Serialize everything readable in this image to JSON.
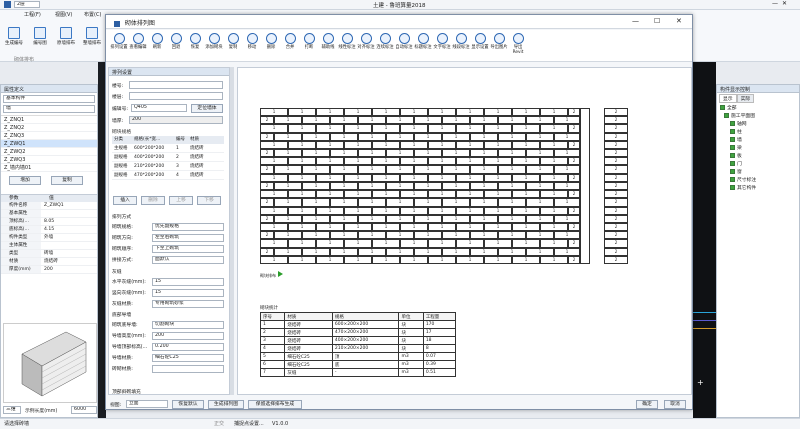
{
  "app": {
    "title": "土建 - 鲁班算量2018",
    "floor": "2层",
    "menus": [
      "工程(F)",
      "视图(V)",
      "布置(C)"
    ],
    "ribbon_tools": [
      "生成编号",
      "编号图",
      "原墙排布",
      "整墙排布"
    ],
    "ribbon_group": "砌体排布"
  },
  "props": {
    "title": "属性定义",
    "filter1": "基本构件",
    "filter2": "墙",
    "items": [
      "Z_ZNQ1",
      "Z_ZNQ2",
      "Z_ZNQ3",
      "Z_ZWQ1",
      "Z_ZWQ2",
      "Z_ZWQ3",
      "Z_墙内墙01"
    ],
    "selected": 3,
    "btn_add": "增加",
    "btn_copy": "复制",
    "grid_head": [
      "参数",
      "值"
    ],
    "rows": [
      [
        "构件名称",
        "Z_ZWQ1"
      ],
      [
        "基本属性",
        ""
      ],
      [
        "顶标高(...",
        "8.05"
      ],
      [
        "底标高(...",
        "4.15"
      ],
      [
        "构件类型",
        "外墙"
      ],
      [
        "主体属性",
        ""
      ],
      [
        "类型",
        "砖墙"
      ],
      [
        "材质",
        "烧结砖"
      ],
      [
        "厚度(mm)",
        "200"
      ]
    ],
    "bottom_view": "三维",
    "bottom_label": "示例长度(mm)",
    "bottom_value": "6000"
  },
  "dialog": {
    "title": "砌体排列图",
    "tools": [
      "排列设置",
      "查看编辑",
      "刷新",
      "回退",
      "恢复",
      "添加砌块",
      "复制",
      "移动",
      "删除",
      "合并",
      "打断",
      "辅助线",
      "线性标注",
      "对齐标注",
      "连续标注",
      "自动标注",
      "标题标注",
      "文字标注",
      "线段标注",
      "显示设置",
      "导出图片",
      "导出Revit"
    ],
    "settings_title": "排列设置",
    "l_floor": "楼号:",
    "l_num": "楼层:",
    "l_code": "编辑号:",
    "code_value": "Q405",
    "btn_locate": "定位墙体",
    "l_height": "墙厚:",
    "height_value": "200",
    "spec_title": "砌块规格",
    "spec_head": [
      "分类",
      "规格(长*宽...",
      "编号",
      "材质"
    ],
    "spec_rows": [
      [
        "主规格",
        "600*200*200",
        "1",
        "烧结砖"
      ],
      [
        "副规格",
        "400*200*200",
        "2",
        "烧结砖"
      ],
      [
        "副规格",
        "210*200*200",
        "3",
        "烧结砖"
      ],
      [
        "副规格",
        "470*200*200",
        "4",
        "烧结砖"
      ]
    ],
    "spec_btns": [
      "插入",
      "删除",
      "上移",
      "下移"
    ],
    "arr_title": "排列方式",
    "arr_rows": [
      [
        "砌筑规格:",
        "优先副规格"
      ],
      [
        "砌筑方向:",
        "左至右砌筑"
      ],
      [
        "砌筑顺序:",
        "下至上砌筑"
      ],
      [
        "拼接方式:",
        "面默认"
      ]
    ],
    "mortar_title": "灰缝",
    "mortar_rows": [
      [
        "水平灰缝(mm):",
        "15"
      ],
      [
        "竖向灰缝(mm):",
        "15"
      ],
      [
        "灰缝材质:",
        "专用砌筑砂浆"
      ]
    ],
    "top_title": "底部导墙",
    "top_rows": [
      [
        "砌筑底导墙:",
        "切割砌块"
      ],
      [
        "导墙高度(mm):",
        "200"
      ],
      [
        "导墙顶部标高(...",
        "0.200"
      ],
      [
        "导墙材质:",
        "细石砼C25"
      ],
      [
        "砖砌材质:",
        ""
      ]
    ],
    "top2_title": "顶部斜砌填充",
    "footer_view_label": "视图:",
    "footer_view": "立面",
    "footer_btns": [
      "恢复默认",
      "生成排列图",
      "保留选择排布生成"
    ],
    "btn_ok": "确定",
    "btn_cancel": "取消",
    "row_right_labels": [
      "2",
      "2",
      "2",
      "2",
      "2",
      "2",
      "2",
      "2",
      "2",
      "2",
      "2",
      "2",
      "2",
      "2",
      "2",
      "2",
      "2",
      "2",
      "2"
    ],
    "drawing_note": "砌块排布",
    "bt_title": "砌块统计",
    "bt_head": [
      "序号",
      "材质",
      "规格",
      "单位",
      "工程量"
    ],
    "bt_rows": [
      [
        "1",
        "烧结砖",
        "600×200×200",
        "块",
        "170"
      ],
      [
        "2",
        "烧结砖",
        "470×200×200",
        "块",
        "17"
      ],
      [
        "3",
        "烧结砖",
        "400×200×200",
        "块",
        "18"
      ],
      [
        "4",
        "烧结砖",
        "210×200×200",
        "块",
        "8"
      ],
      [
        "5",
        "细石砼C25",
        "顶",
        "m3",
        "0.07"
      ],
      [
        "6",
        "细石砼C25",
        "底",
        "m3",
        "0.39"
      ],
      [
        "7",
        "灰缝",
        "-",
        "m3",
        "0.51"
      ]
    ]
  },
  "right": {
    "title": "构件显示控制",
    "tabs": [
      "显示",
      "实际"
    ],
    "tree": [
      "全部",
      "施工平面图",
      "轴网",
      "柱",
      "墙",
      "梁",
      "板",
      "门",
      "窗",
      "尺寸标注",
      "其它构件"
    ]
  },
  "status": {
    "left": "请选择砖墙",
    "mid1": "正交",
    "mid2": "捕捉点设置...",
    "ver": "V1.0.0"
  }
}
